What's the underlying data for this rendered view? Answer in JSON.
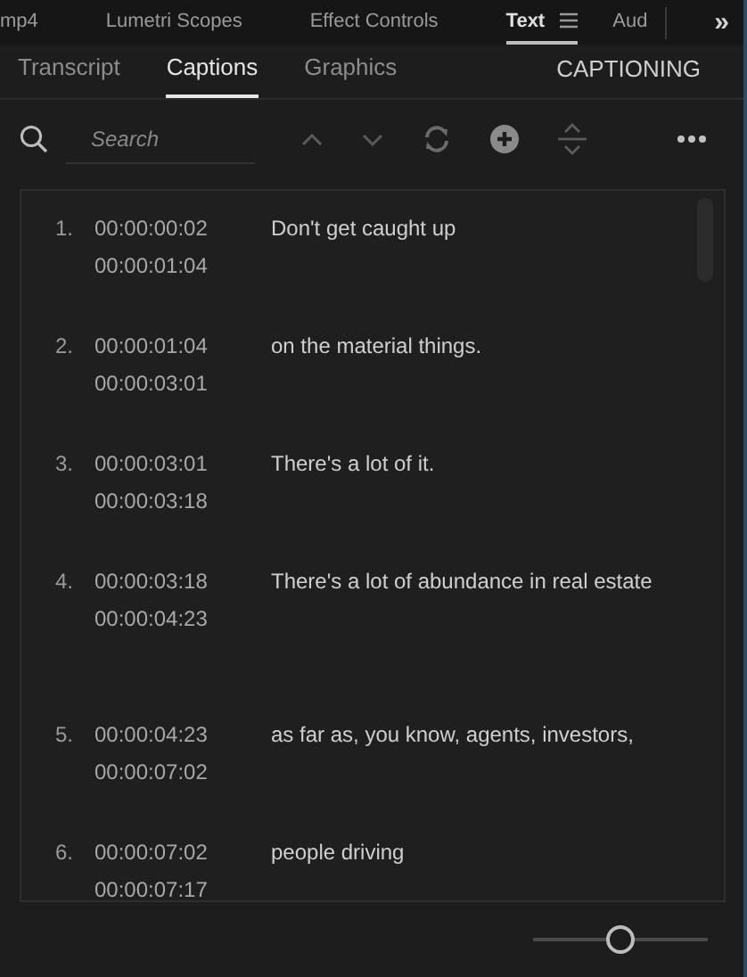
{
  "panel_tabs": [
    {
      "label": "mp4",
      "selected": false
    },
    {
      "label": "Lumetri Scopes",
      "selected": false
    },
    {
      "label": "Effect Controls",
      "selected": false
    },
    {
      "label": "Text",
      "selected": true
    },
    {
      "label": "Aud",
      "selected": false
    }
  ],
  "overflow": "»",
  "sub_tabs": [
    {
      "label": "Transcript",
      "selected": false
    },
    {
      "label": "Captions",
      "selected": true
    },
    {
      "label": "Graphics",
      "selected": false
    }
  ],
  "mode_label": "CAPTIONING",
  "search": {
    "placeholder": "Search"
  },
  "captions": [
    {
      "number": "1.",
      "start": "00:00:00:02",
      "end": "00:00:01:04",
      "text": "Don't get caught up"
    },
    {
      "number": "2.",
      "start": "00:00:01:04",
      "end": "00:00:03:01",
      "text": "on the material things."
    },
    {
      "number": "3.",
      "start": "00:00:03:01",
      "end": "00:00:03:18",
      "text": "There's a lot of it."
    },
    {
      "number": "4.",
      "start": "00:00:03:18",
      "end": "00:00:04:23",
      "text": "There's a lot of abundance in real estate"
    },
    {
      "number": "5.",
      "start": "00:00:04:23",
      "end": "00:00:07:02",
      "text": "as far as, you know, agents, investors,"
    },
    {
      "number": "6.",
      "start": "00:00:07:02",
      "end": "00:00:07:17",
      "text": "people driving"
    }
  ],
  "zoom_slider": {
    "level": 0.5
  }
}
